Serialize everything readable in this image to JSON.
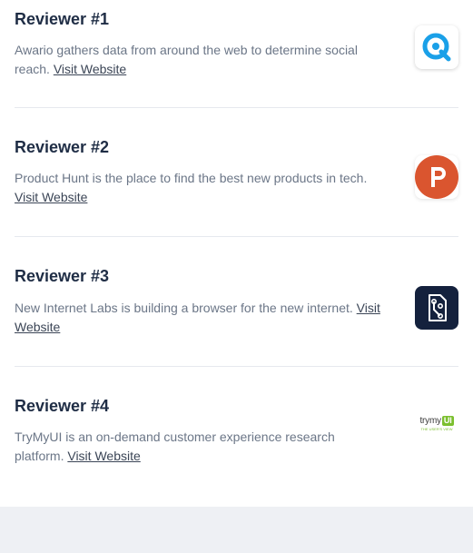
{
  "reviewers": [
    {
      "title": "Reviewer #1",
      "description": "Awario gathers data from around the web to determine social reach.",
      "link_label": "Visit Website",
      "logo_icon": "awario-logo-icon",
      "logo_color": "#1aa0e8"
    },
    {
      "title": "Reviewer #2",
      "description": "Product Hunt is the place to find the best new products in tech.",
      "link_label": "Visit Website",
      "logo_icon": "product-hunt-logo-icon",
      "logo_color": "#da552f"
    },
    {
      "title": "Reviewer #3",
      "description": "New Internet Labs is building a browser for the new internet.",
      "link_label": "Visit Website",
      "logo_icon": "new-internet-labs-logo-icon",
      "logo_color": "#14213d"
    },
    {
      "title": "Reviewer #4",
      "description": "TryMyUI is an on-demand customer experience research platform.",
      "link_label": "Visit Website",
      "logo_icon": "trymyui-logo-icon",
      "logo_color": "#7bbf2e",
      "logo_text": "trymy",
      "logo_badge": "UI",
      "logo_subtext": "THE USER'S VIEW"
    }
  ],
  "colors": {
    "title": "#1f2d45",
    "text": "#6b7687",
    "link": "#3b4556",
    "divider": "#e6e9ee",
    "footer_band": "#eef0f4"
  }
}
